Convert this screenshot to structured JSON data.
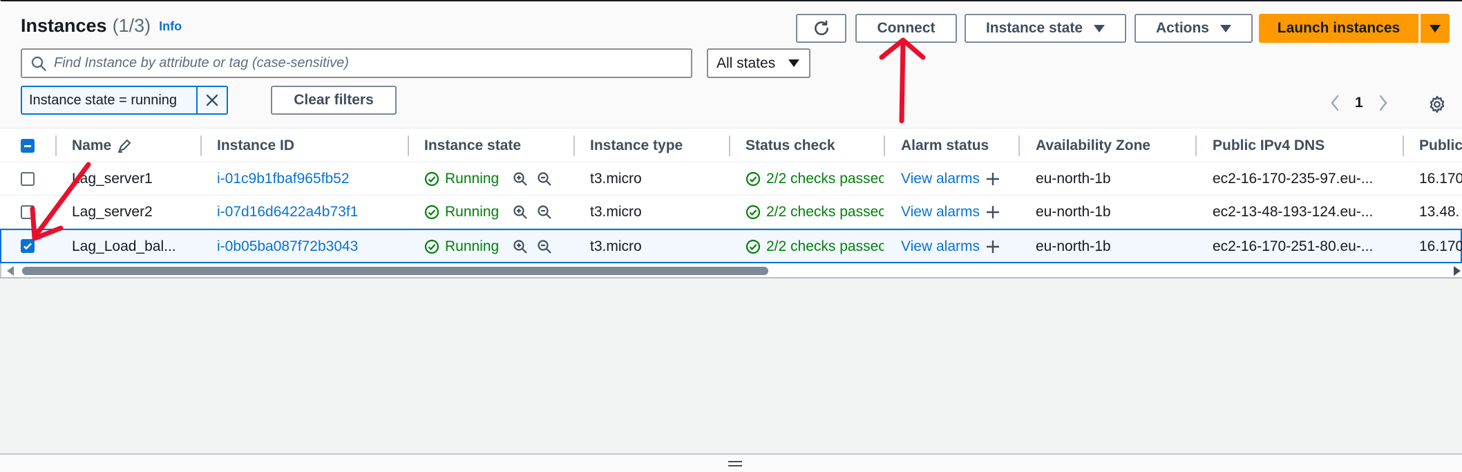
{
  "header": {
    "title": "Instances",
    "count": "(1/3)",
    "info_label": "Info"
  },
  "toolbar": {
    "connect_label": "Connect",
    "instance_state_label": "Instance state",
    "actions_label": "Actions",
    "launch_label": "Launch instances"
  },
  "search": {
    "placeholder": "Find Instance by attribute or tag (case-sensitive)"
  },
  "state_filter": {
    "selected": "All states"
  },
  "filter_token": {
    "label": "Instance state = running"
  },
  "clear_filters_label": "Clear filters",
  "pagination": {
    "current_page": "1"
  },
  "table": {
    "columns": [
      "Name",
      "Instance ID",
      "Instance state",
      "Instance type",
      "Status check",
      "Alarm status",
      "Availability Zone",
      "Public IPv4 DNS",
      "Public"
    ],
    "rows": [
      {
        "name": "Lag_server1",
        "instance_id": "i-01c9b1fbaf965fb52",
        "state": "Running",
        "type": "t3.micro",
        "status_check": "2/2 checks passec",
        "alarm": "View alarms",
        "az": "eu-north-1b",
        "dns": "ec2-16-170-235-97.eu-...",
        "public_ip": "16.170",
        "selected": false
      },
      {
        "name": "Lag_server2",
        "instance_id": "i-07d16d6422a4b73f1",
        "state": "Running",
        "type": "t3.micro",
        "status_check": "2/2 checks passec",
        "alarm": "View alarms",
        "az": "eu-north-1b",
        "dns": "ec2-13-48-193-124.eu-...",
        "public_ip": "13.48.",
        "selected": false
      },
      {
        "name": "Lag_Load_bal...",
        "instance_id": "i-0b05ba087f72b3043",
        "state": "Running",
        "type": "t3.micro",
        "status_check": "2/2 checks passec",
        "alarm": "View alarms",
        "az": "eu-north-1b",
        "dns": "ec2-16-170-251-80.eu-...",
        "public_ip": "16.170",
        "selected": true
      }
    ]
  },
  "colors": {
    "accent": "#0972d3",
    "launch": "#ff9900",
    "success": "#037f0c",
    "annotation": "#e8102a"
  }
}
